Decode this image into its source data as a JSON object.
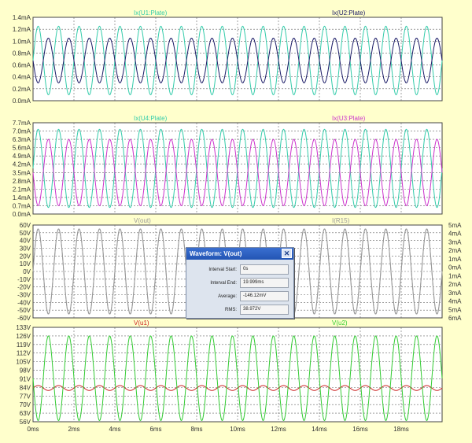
{
  "chart_data": [
    {
      "type": "line",
      "panel": 1,
      "y_ticks": [
        "1.4mA",
        "1.2mA",
        "1.0mA",
        "0.8mA",
        "0.6mA",
        "0.4mA",
        "0.2mA",
        "0.0mA"
      ],
      "ylim": [
        0.0,
        1.4
      ],
      "y_unit": "mA",
      "series": [
        {
          "name": "Ix(U1:Plate)",
          "color": "#33ccaa",
          "axis": "left",
          "wave": {
            "offset": 0.675,
            "amplitude": 0.575,
            "frequency_kHz": 1.0,
            "phase_deg": 0
          }
        },
        {
          "name": "Ix(U2:Plate)",
          "color": "#1a1a66",
          "axis": "left",
          "wave": {
            "offset": 0.675,
            "amplitude": 0.375,
            "frequency_kHz": 1.0,
            "phase_deg": 180
          }
        }
      ]
    },
    {
      "type": "line",
      "panel": 2,
      "y_ticks": [
        "7.7mA",
        "7.0mA",
        "6.3mA",
        "5.6mA",
        "4.9mA",
        "4.2mA",
        "3.5mA",
        "2.8mA",
        "2.1mA",
        "1.4mA",
        "0.7mA",
        "0.0mA"
      ],
      "ylim": [
        0.0,
        7.7
      ],
      "y_unit": "mA",
      "series": [
        {
          "name": "Ix(U4:Plate)",
          "color": "#33ccaa",
          "axis": "left",
          "wave": {
            "offset": 3.85,
            "amplitude": 3.3,
            "frequency_kHz": 1.0,
            "phase_deg": 0
          }
        },
        {
          "name": "Ix(U3:Plate)",
          "color": "#cc33cc",
          "axis": "left",
          "wave": {
            "offset": 3.5,
            "amplitude": 2.8,
            "frequency_kHz": 1.0,
            "phase_deg": 180
          }
        }
      ]
    },
    {
      "type": "line",
      "panel": 3,
      "y_ticks": [
        "60V",
        "50V",
        "40V",
        "30V",
        "20V",
        "10V",
        "0V",
        "-10V",
        "-20V",
        "-30V",
        "-40V",
        "-50V",
        "-60V"
      ],
      "y_right_ticks": [
        "5mA",
        "4mA",
        "3mA",
        "2mA",
        "1mA",
        "0mA",
        "1mA",
        "2mA",
        "3mA",
        "4mA",
        "5mA",
        "6mA"
      ],
      "ylim": [
        -60,
        60
      ],
      "y_unit": "V",
      "series": [
        {
          "name": "V(out)",
          "color": "#999999",
          "axis": "left",
          "wave": {
            "offset": 0,
            "amplitude": 55,
            "frequency_kHz": 1.0,
            "phase_deg": 0
          }
        },
        {
          "name": "I(R15)",
          "color": "#999999",
          "axis": "right",
          "wave": {
            "offset": 0,
            "amplitude": 55,
            "frequency_kHz": 1.0,
            "phase_deg": 0
          }
        }
      ]
    },
    {
      "type": "line",
      "panel": 4,
      "y_ticks": [
        "133V",
        "126V",
        "119V",
        "112V",
        "105V",
        "98V",
        "91V",
        "84V",
        "77V",
        "70V",
        "63V",
        "56V"
      ],
      "ylim": [
        56,
        133
      ],
      "y_unit": "V",
      "series": [
        {
          "name": "V(u1)",
          "color": "#cc2222",
          "axis": "left",
          "wave": {
            "offset": 83.5,
            "amplitude": 2.0,
            "frequency_kHz": 1.0,
            "phase_deg": 0
          }
        },
        {
          "name": "V(u2)",
          "color": "#33cc33",
          "axis": "left",
          "wave": {
            "offset": 91.5,
            "amplitude": 34.5,
            "frequency_kHz": 1.0,
            "phase_deg": 180
          }
        }
      ]
    }
  ],
  "x_axis": {
    "ticks": [
      "0ms",
      "2ms",
      "4ms",
      "6ms",
      "8ms",
      "10ms",
      "12ms",
      "14ms",
      "16ms",
      "18ms"
    ],
    "tick_values": [
      0,
      2,
      4,
      6,
      8,
      10,
      12,
      14,
      16,
      18
    ],
    "xlim": [
      0,
      20
    ],
    "unit": "ms"
  },
  "grid": true,
  "colors": {
    "background": "#ffffcc",
    "plot_bg": "#ffffff",
    "grid": "#666666",
    "frame": "#444444"
  },
  "waveform_dialog": {
    "title": "Waveform: V(out)",
    "close_icon": "close-icon",
    "rows": [
      {
        "label": "Interval Start:",
        "value": "0s"
      },
      {
        "label": "Interval End:",
        "value": "19.999ms"
      },
      {
        "label": "Average:",
        "value": "-146.12mV"
      },
      {
        "label": "RMS:",
        "value": "38.972V"
      }
    ]
  }
}
